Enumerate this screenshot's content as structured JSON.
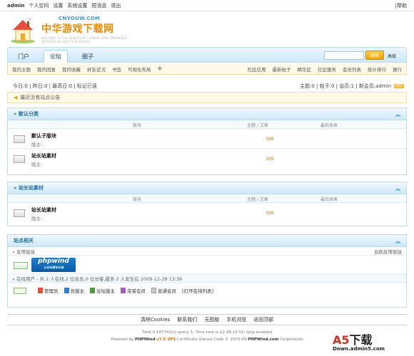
{
  "topbar": {
    "user": "admin",
    "links": [
      "个人空间",
      "设置",
      "系统设置",
      "短消息",
      "退出"
    ],
    "help": "|帮助"
  },
  "logo": {
    "en": "CNYOUW.COM",
    "cn": "中华游戏下载网",
    "small": "WELCOME TO THE WEBSITE OF CHINESE GAME DOWNLOAD NETWORK ALL RIGHTS RESERVED"
  },
  "nav": {
    "tabs": [
      "门户",
      "论坛",
      "圈子"
    ],
    "search_button": "搜索",
    "advanced": "高级"
  },
  "subnav": {
    "left": [
      "我的主题",
      "我的回复",
      "我的收藏",
      "好友近况",
      "书签",
      "可视化布局"
    ],
    "right": [
      "社区应用",
      "最新帖子",
      "精华区",
      "社区服务",
      "会员列表",
      "统计排行",
      "操行"
    ]
  },
  "stats": {
    "left": "今日:0 | 昨日:0 | 最高日:0 | 标记已读",
    "right": "主题:0 | 帖子:0 | 会员:1 | 新会员:admin",
    "rss": "RSS"
  },
  "announcement": "最近没有站点公告",
  "columns": {
    "board": "版块",
    "topics": "主题 / 文章",
    "latest": "最后发表"
  },
  "sections": [
    {
      "title": "» 默认分类",
      "forums": [
        {
          "name": "默认子版块",
          "moderator": "版主:",
          "count": "0/0"
        },
        {
          "name": "站长站素材",
          "moderator": "版主:",
          "count": "0/0"
        }
      ]
    },
    {
      "title": "» 站长站素材",
      "forums": [
        {
          "name": "站长站素材",
          "moderator": "版主:",
          "count": "0/0"
        }
      ]
    }
  ],
  "site": {
    "title": "站点相关",
    "friend_links": "» 友情链接",
    "auto_link": "自助友情链接",
    "phpwind": "phpwind",
    "phpwind_sub": "让论坛更有价值",
    "online": "» 在线用户 - 共 2 人在线,2 位会员,0 位访客,最多 2 人发生在 2009-12-28 13:36",
    "legend": [
      "管理员",
      "总版主",
      "论坛版主",
      "荣誉会员",
      "普通会员",
      "[打开在线列表]"
    ]
  },
  "legend_colors": [
    "#e84c3d",
    "#2d7fd3",
    "#4a9e3a",
    "#b054c8",
    "#999999"
  ],
  "footer": {
    "links": [
      "清除Cookies",
      "联系我们",
      "无图版",
      "手机浏览",
      "返回顶部"
    ],
    "line1": "Total 0.197742(s) query 3, Time now is:12-28 13:52, Gzip enabled",
    "line2_a": "Powered by",
    "line2_b": "PHPWind",
    "line2_c": "v7.5 SP1",
    "line2_d": "Certificate  Games Code © 2003-09",
    "line2_e": "PHPWind.com",
    "line2_f": "Corporation"
  },
  "watermark": {
    "a5": "A5",
    "xz": "下载",
    "domain": "Down.admin5.com"
  }
}
